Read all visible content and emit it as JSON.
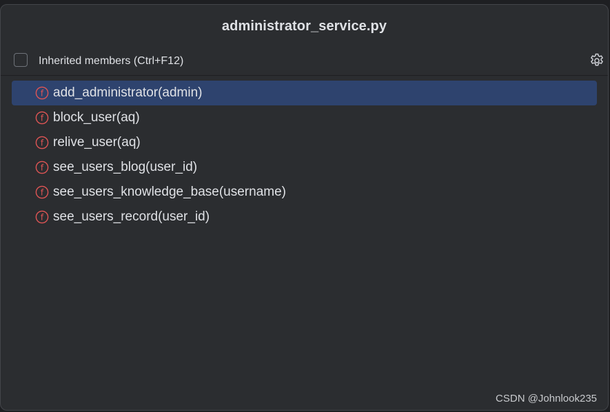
{
  "popup": {
    "title": "administrator_service.py"
  },
  "options": {
    "inherited_label": "Inherited members (Ctrl+F12)",
    "inherited_checked": false,
    "settings_icon": "gear-icon"
  },
  "members": [
    {
      "label": "add_administrator(admin)",
      "icon": "function-icon",
      "selected": true
    },
    {
      "label": "block_user(aq)",
      "icon": "function-icon",
      "selected": false
    },
    {
      "label": "relive_user(aq)",
      "icon": "function-icon",
      "selected": false
    },
    {
      "label": "see_users_blog(user_id)",
      "icon": "function-icon",
      "selected": false
    },
    {
      "label": "see_users_knowledge_base(username)",
      "icon": "function-icon",
      "selected": false
    },
    {
      "label": "see_users_record(user_id)",
      "icon": "function-icon",
      "selected": false
    }
  ],
  "colors": {
    "background": "#2b2d30",
    "selection": "#2e436e",
    "function_icon": "#e05555",
    "text": "#dfe1e5"
  },
  "watermark": "CSDN @Johnlook235"
}
